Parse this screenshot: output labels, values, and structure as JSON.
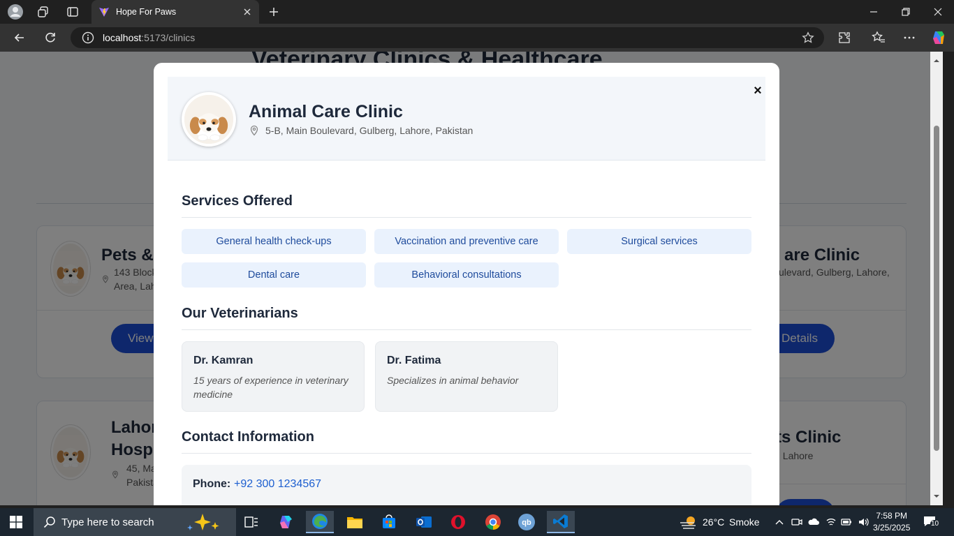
{
  "browser": {
    "tab_title": "Hope For Paws",
    "url_host": "localhost",
    "url_path": ":5173/clinics"
  },
  "page": {
    "heading": "Veterinary Clinics & Healthcare",
    "cards": [
      {
        "title": "Pets &",
        "address_line1": "143 Block",
        "address_line2": "Area, Lah",
        "button": "View"
      },
      {
        "title": "are Clinic",
        "address_line1": "ulevard, Gulberg, Lahore,",
        "button": "Details"
      },
      {
        "title_line1": "Lahor",
        "title_line2": "Hosp",
        "address_line1": "45, Ma",
        "address_line2": "Pakista"
      },
      {
        "title": "ts Clinic",
        "address_line1": ", Lahore"
      }
    ]
  },
  "modal": {
    "clinic_name": "Animal Care Clinic",
    "address": "5-B, Main Boulevard, Gulberg, Lahore, Pakistan",
    "close_label": "×",
    "services_title": "Services Offered",
    "services": [
      "General health check-ups",
      "Vaccination and preventive care",
      "Surgical services",
      "Dental care",
      "Behavioral consultations"
    ],
    "vets_title": "Our Veterinarians",
    "vets": [
      {
        "name": "Dr. Kamran",
        "description": "15 years of experience in veterinary medicine"
      },
      {
        "name": "Dr. Fatima",
        "description": "Specializes in animal behavior"
      }
    ],
    "contact_title": "Contact Information",
    "phone_label": "Phone:",
    "phone_value": "+92 300 1234567"
  },
  "taskbar": {
    "search_placeholder": "Type here to search",
    "weather_temp": "26°C",
    "weather_desc": "Smoke",
    "time": "7:58 PM",
    "date": "3/25/2025",
    "notification_count": "10"
  },
  "colors": {
    "accent": "#1d4ed8",
    "service_bg": "#eaf2fd",
    "service_text": "#1e4b9c",
    "link": "#1d5fd0"
  }
}
